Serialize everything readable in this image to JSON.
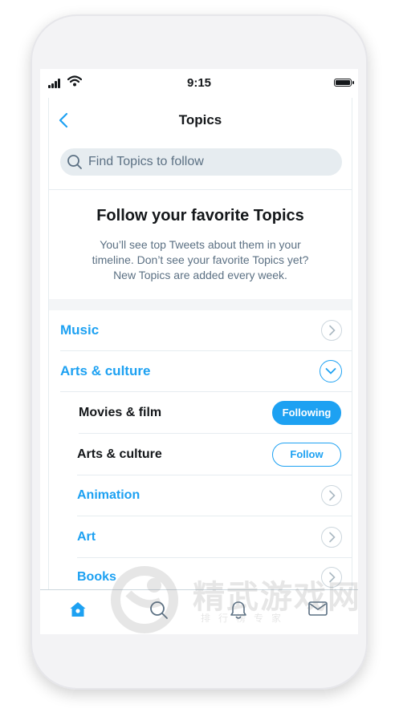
{
  "status_bar": {
    "time": "9:15"
  },
  "nav": {
    "title": "Topics"
  },
  "search": {
    "placeholder": "Find Topics to follow"
  },
  "intro": {
    "title": "Follow your favorite Topics",
    "text": "You’ll see top Tweets about them in your timeline. Don’t see your favorite Topics yet? New Topics are added every week."
  },
  "categories": [
    {
      "label": "Music",
      "expanded": false
    },
    {
      "label": "Arts & culture",
      "expanded": true
    }
  ],
  "subtopics": [
    {
      "label": "Movies & film",
      "button": "Following"
    },
    {
      "label": "Arts & culture",
      "button": "Follow"
    },
    {
      "label": "Animation"
    },
    {
      "label": "Art"
    },
    {
      "label": "Books"
    }
  ],
  "tabbar": {
    "tabs": [
      {
        "icon": "home-icon",
        "active": true
      },
      {
        "icon": "search-icon",
        "active": false
      },
      {
        "icon": "bell-icon",
        "active": false
      },
      {
        "icon": "mail-icon",
        "active": false
      }
    ]
  },
  "watermark": {
    "text": "精武游戏网",
    "subtext": "排行榜专家"
  },
  "colors": {
    "accent": "#1da1f2",
    "secondary_text": "#5b7083",
    "divider": "#e6ecf0"
  }
}
